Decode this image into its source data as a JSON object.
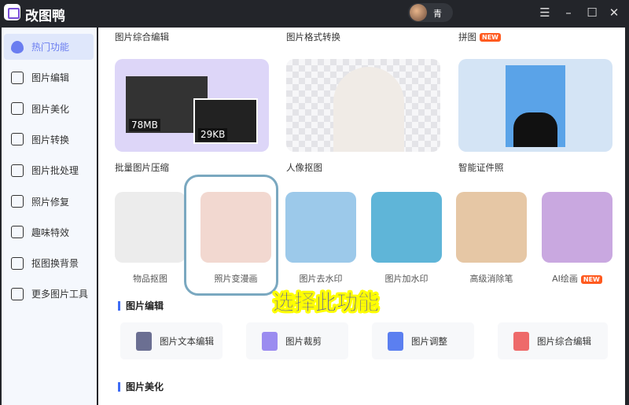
{
  "app": {
    "title": "改图鸭",
    "user": "青"
  },
  "window_icons": [
    "menu-icon",
    "minimize-icon",
    "maximize-icon",
    "close-icon"
  ],
  "sidebar": {
    "items": [
      {
        "label": "热门功能",
        "icon": "fire-icon",
        "active": true
      },
      {
        "label": "图片编辑",
        "icon": "image-edit-icon"
      },
      {
        "label": "图片美化",
        "icon": "image-beautify-icon"
      },
      {
        "label": "图片转换",
        "icon": "convert-icon"
      },
      {
        "label": "图片批处理",
        "icon": "batch-icon"
      },
      {
        "label": "照片修复",
        "icon": "photo-repair-icon"
      },
      {
        "label": "趣味特效",
        "icon": "magic-wand-icon"
      },
      {
        "label": "抠图换背景",
        "icon": "cutout-icon"
      },
      {
        "label": "更多图片工具",
        "icon": "toolbox-icon"
      }
    ]
  },
  "top_labels": [
    "图片综合编辑",
    "图片格式转换",
    "拼图"
  ],
  "new_badge": "NEW",
  "big_cards": [
    {
      "label": "批量图片压缩",
      "before": "78MB",
      "after": "29KB",
      "color": "#ddd6f8"
    },
    {
      "label": "人像抠图",
      "color": "#e8e8ec"
    },
    {
      "label": "智能证件照",
      "color": "#d4e4f5"
    }
  ],
  "small_cards": [
    {
      "label": "物品抠图",
      "color": "#ececec"
    },
    {
      "label": "照片变漫画",
      "color": "#f2d8d0"
    },
    {
      "label": "图片去水印",
      "color": "#9cc9ea"
    },
    {
      "label": "图片加水印",
      "color": "#5fb5d8"
    },
    {
      "label": "高级消除笔",
      "color": "#e6c7a5"
    },
    {
      "label": "AI绘画",
      "color": "#c9a8e0",
      "new": true
    }
  ],
  "annotation": "选择此功能",
  "sections": {
    "edit": "图片编辑",
    "beautify": "图片美化"
  },
  "tools": [
    {
      "label": "图片文本编辑",
      "icon": "text-edit-icon",
      "color": "#6b6f92"
    },
    {
      "label": "图片裁剪",
      "icon": "crop-icon",
      "color": "#9b8cf0"
    },
    {
      "label": "图片调整",
      "icon": "adjust-icon",
      "color": "#5b7ff0"
    },
    {
      "label": "图片综合编辑",
      "icon": "image-composite-icon",
      "color": "#ee6a6a"
    }
  ]
}
